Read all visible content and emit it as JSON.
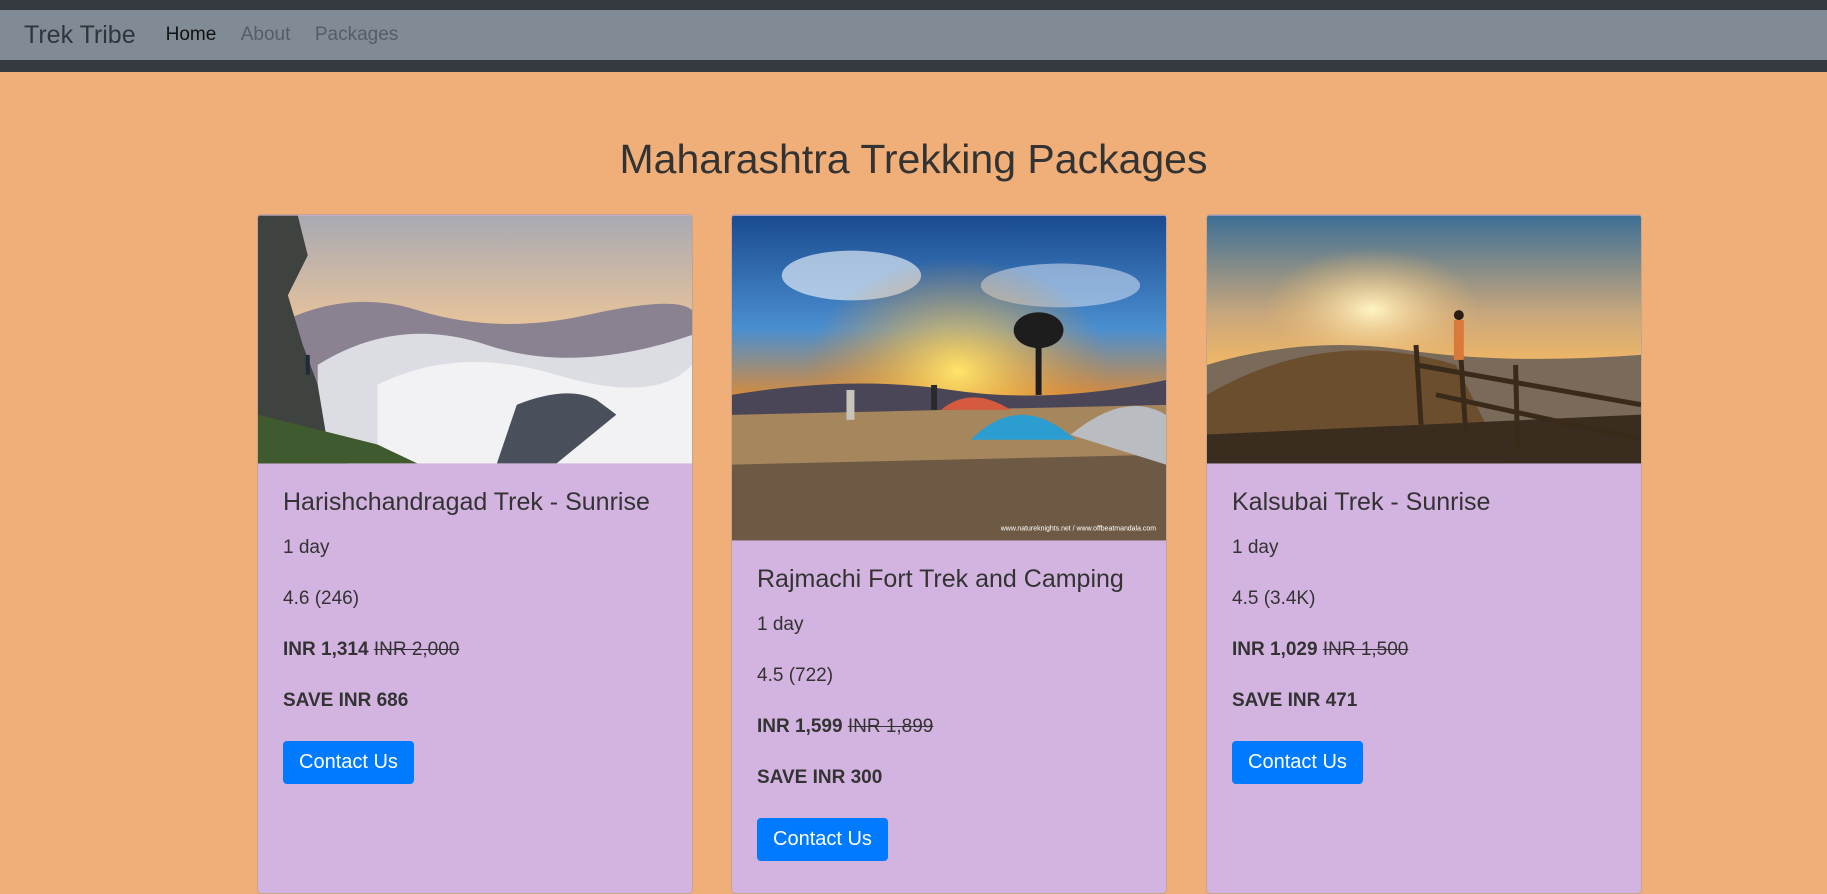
{
  "navbar": {
    "brand": "Trek Tribe",
    "links": [
      "Home",
      "About",
      "Packages"
    ]
  },
  "page": {
    "heading": "Maharashtra Trekking Packages"
  },
  "packages": [
    {
      "title": "Harishchandragad Trek - Sunrise",
      "duration": "1 day",
      "rating": "4.6 (246)",
      "price": "INR 1,314",
      "old_price": "INR 2,000",
      "save": "SAVE INR 686",
      "button": "Contact Us"
    },
    {
      "title": "Rajmachi Fort Trek and Camping",
      "duration": "1 day",
      "rating": "4.5 (722)",
      "price": "INR 1,599",
      "old_price": "INR 1,899",
      "save": "SAVE INR 300",
      "button": "Contact Us",
      "image_credit": "www.natureknights.net / www.offbeatmandala.com"
    },
    {
      "title": "Kalsubai Trek - Sunrise",
      "duration": "1 day",
      "rating": "4.5 (3.4K)",
      "price": "INR 1,029",
      "old_price": "INR 1,500",
      "save": "SAVE INR 471",
      "button": "Contact Us"
    }
  ],
  "colors": {
    "background": "#f0af78",
    "navbar": "#808b96",
    "card": "#d3b3e0",
    "button": "#007bff"
  }
}
